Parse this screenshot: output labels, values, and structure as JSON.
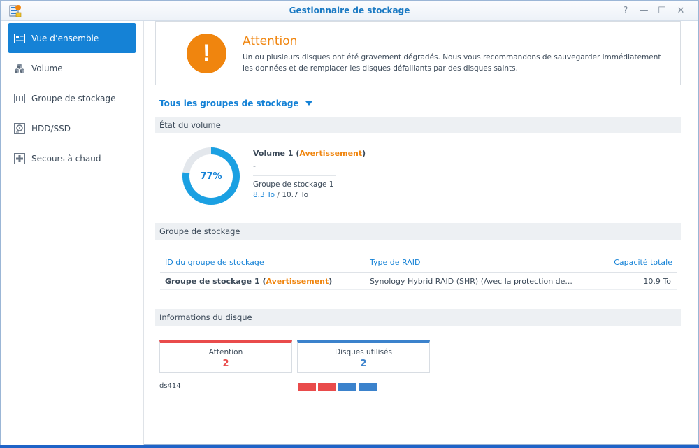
{
  "window": {
    "title": "Gestionnaire de stockage",
    "icons": [
      "storage-manager-app-icon",
      "help-icon",
      "minimize-icon",
      "maximize-icon",
      "close-icon"
    ],
    "help_glyph": "?",
    "minimize_glyph": "—",
    "maximize_glyph": "☐",
    "close_glyph": "✕"
  },
  "colors": {
    "accent": "#1582d6",
    "warning": "#f0850e",
    "danger": "#e94b4b",
    "desktop": "#1f63c7"
  },
  "sidebar": {
    "items": [
      {
        "label": "Vue d’ensemble",
        "icon": "overview-icon",
        "active": true
      },
      {
        "label": "Volume",
        "icon": "volume-cubes-icon",
        "active": false
      },
      {
        "label": "Groupe de stockage",
        "icon": "storage-pool-icon",
        "active": false
      },
      {
        "label": "HDD/SSD",
        "icon": "hdd-icon",
        "active": false
      },
      {
        "label": "Secours à chaud",
        "icon": "hot-spare-icon",
        "active": false
      }
    ]
  },
  "alert": {
    "icon": "exclamation-icon",
    "badge_glyph": "!",
    "title": "Attention",
    "message": "Un ou plusieurs disques ont été gravement dégradés. Nous vous recommandons de sauvegarder immédiatement les données et de remplacer les disques défaillants par des disques saints."
  },
  "group_selector": {
    "label": "Tous les groupes de stockage",
    "icon": "caret-down-icon"
  },
  "volume_section": {
    "header": "État du volume",
    "usage_percent": 77,
    "usage_label": "77%",
    "volume_name": "Volume 1",
    "status_open": " (",
    "status": "Avertissement",
    "status_close": ")",
    "description": "-",
    "pool_name": "Groupe de stockage 1",
    "used": "8.3 To",
    "separator": " / ",
    "total": "10.7 To"
  },
  "pool_section": {
    "header": "Groupe de stockage",
    "columns": [
      "ID du groupe de stockage",
      "Type de RAID",
      "Capacité totale"
    ],
    "rows": [
      {
        "id": "Groupe de stockage 1",
        "status_open": " (",
        "status": "Avertissement",
        "status_close": ")",
        "raid_type": "Synology Hybrid RAID (SHR) (Avec la protection de...",
        "capacity": "10.9 To"
      }
    ]
  },
  "disk_section": {
    "header": "Informations du disque",
    "cards": [
      {
        "label": "Attention",
        "value": "2",
        "color": "#e94b4b"
      },
      {
        "label": "Disques utilisés",
        "value": "2",
        "color": "#3b82cc"
      }
    ],
    "host": "ds414",
    "slots": [
      {
        "state": "attention",
        "color": "#e94b4b"
      },
      {
        "state": "attention",
        "color": "#e94b4b"
      },
      {
        "state": "used",
        "color": "#3b82cc"
      },
      {
        "state": "used",
        "color": "#3b82cc"
      }
    ]
  }
}
